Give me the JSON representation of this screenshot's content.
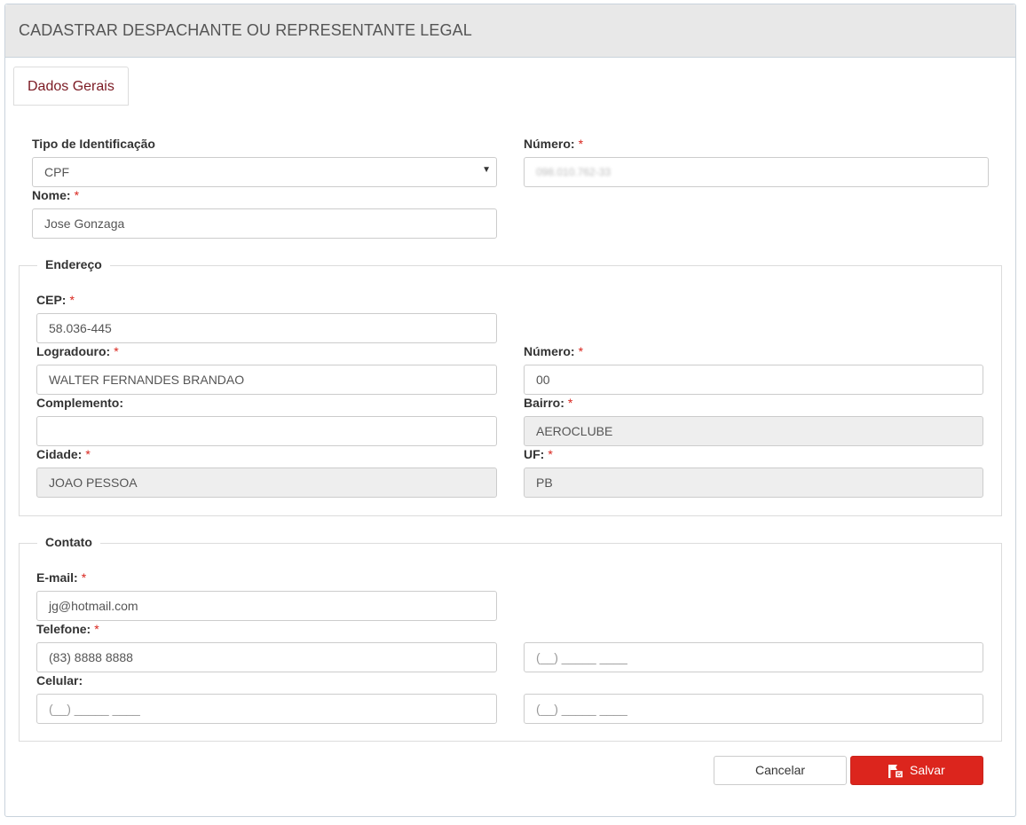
{
  "header": {
    "title": "CADASTRAR DESPACHANTE OU REPRESENTANTE LEGAL"
  },
  "tabs": [
    {
      "label": "Dados Gerais"
    }
  ],
  "required_marker": "*",
  "colors": {
    "accent": "#dc251d",
    "tab_text": "#7b1a23",
    "header_bg": "#e8e8e8",
    "readonly_bg": "#eeeeee"
  },
  "identification": {
    "tipo_label": "Tipo de Identificação",
    "tipo_value": "CPF",
    "numero_label": "Número:",
    "numero_value": "098.010.762-33",
    "nome_label": "Nome:",
    "nome_value": "Jose Gonzaga"
  },
  "address": {
    "legend": "Endereço",
    "cep_label": "CEP:",
    "cep_value": "58.036-445",
    "logradouro_label": "Logradouro:",
    "logradouro_value": "WALTER FERNANDES BRANDAO",
    "numero_label": "Número:",
    "numero_value": "00",
    "complemento_label": "Complemento:",
    "complemento_value": "",
    "bairro_label": "Bairro:",
    "bairro_value": "AEROCLUBE",
    "cidade_label": "Cidade:",
    "cidade_value": "JOAO PESSOA",
    "uf_label": "UF:",
    "uf_value": "PB"
  },
  "contact": {
    "legend": "Contato",
    "email_label": "E-mail:",
    "email_value": "jg@hotmail.com",
    "telefone_label": "Telefone:",
    "telefone_value": "(83) 8888 8888",
    "telefone2_placeholder": "(__) _____ ____",
    "celular_label": "Celular:",
    "celular_placeholder": "(__) _____ ____",
    "celular2_placeholder": "(__) _____ ____"
  },
  "actions": {
    "cancel_label": "Cancelar",
    "save_label": "Salvar",
    "save_icon": "save-flag-icon"
  }
}
